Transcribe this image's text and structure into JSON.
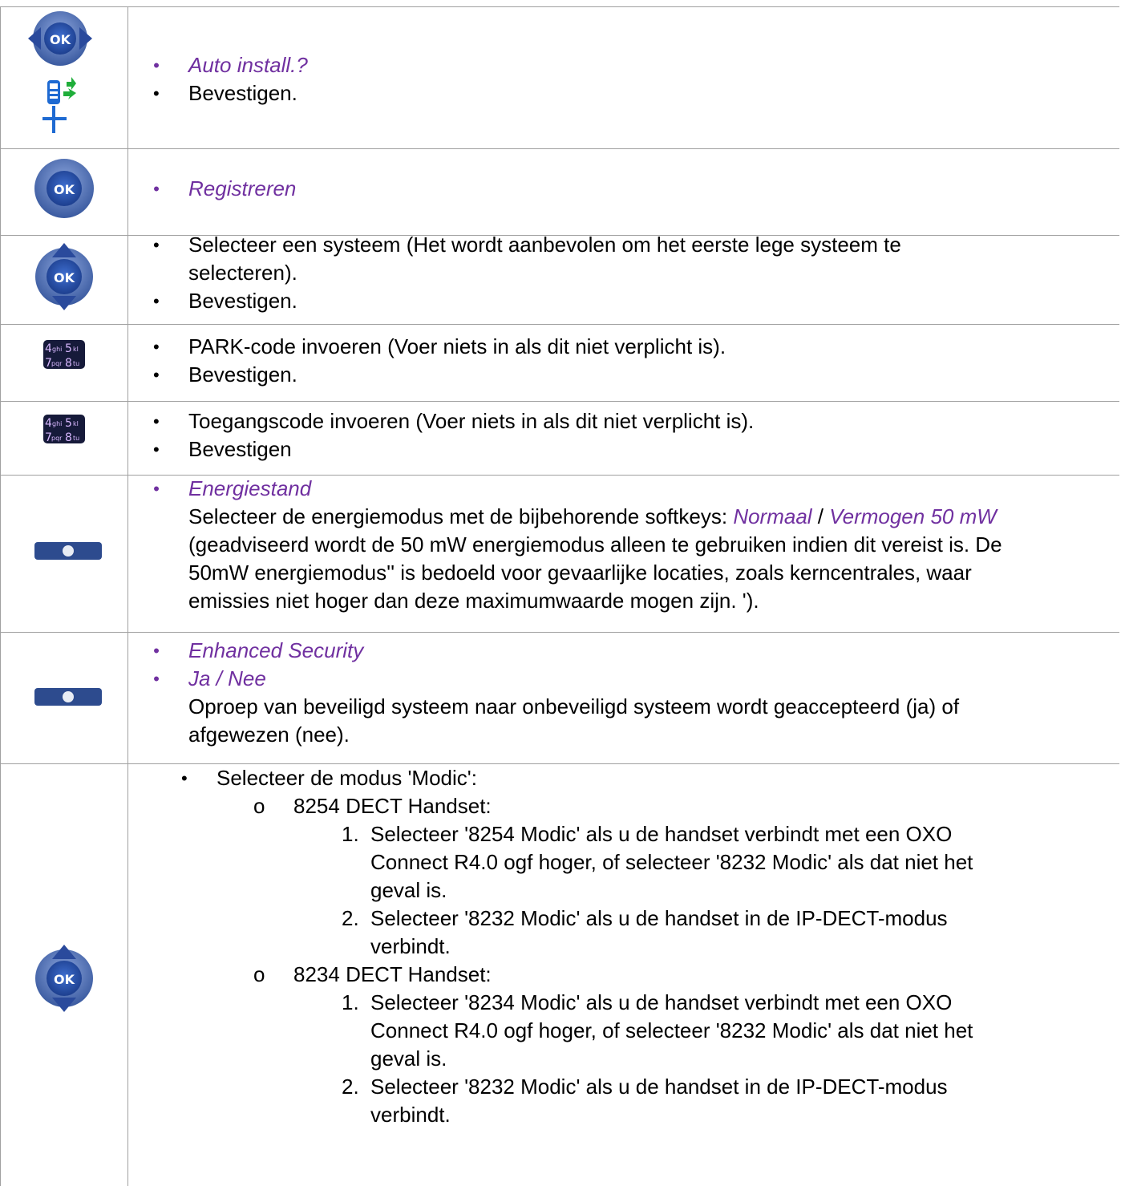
{
  "rows": [
    {
      "icon": "ok-left-right-nav-icon",
      "icon2": "handset-install-icon",
      "items": [
        {
          "text": "Auto install.?",
          "style": "option"
        },
        {
          "text": "Bevestigen.",
          "style": "plain"
        }
      ]
    },
    {
      "icon": "ok-button-icon",
      "items": [
        {
          "text": "Registreren",
          "style": "option"
        }
      ]
    },
    {
      "icon": "ok-up-down-nav-icon",
      "items": [
        {
          "text": "Selecteer een systeem (Het wordt aanbevolen om het eerste lege systeem te",
          "cont": "selecteren).",
          "style": "plain"
        },
        {
          "text": "Bevestigen.",
          "style": "plain"
        }
      ]
    },
    {
      "icon": "keypad-icon",
      "items": [
        {
          "text": "PARK-code invoeren (Voer niets in als dit niet verplicht is).",
          "style": "plain"
        },
        {
          "text": "Bevestigen.",
          "style": "plain"
        }
      ]
    },
    {
      "icon": "keypad-icon",
      "items": [
        {
          "text": "Toegangscode invoeren (Voer niets in als dit niet verplicht is).",
          "style": "plain"
        },
        {
          "text": "Bevestigen",
          "style": "plain"
        }
      ]
    },
    {
      "icon": "softkey-icon",
      "title": "Energiestand",
      "lead": "Selecteer de energiemodus met de bijbehorende softkeys: ",
      "opt_a": "Normaal",
      "sep": " / ",
      "opt_b": "Vermogen 50 mW",
      "lines": [
        "(geadviseerd wordt de 50 mW energiemodus alleen te gebruiken indien dit vereist is. De",
        "50mW energiemodus'' is bedoeld voor gevaarlijke locaties, zoals kerncentrales, waar",
        "emissies niet hoger dan deze maximumwaarde mogen zijn. ')."
      ]
    },
    {
      "icon": "softkey-icon",
      "title": "Enhanced Security",
      "title2": "Ja / Nee",
      "lines": [
        "Oproep van beveiligd systeem naar onbeveiligd systeem wordt geaccepteerd (ja) of",
        "afgewezen (nee)."
      ]
    },
    {
      "icon": "ok-up-down-nav-icon",
      "head": "Selecteer de modus 'Modic':",
      "groups": [
        {
          "label": "8254 DECT Handset:",
          "steps": [
            {
              "num": "1.",
              "lines": [
                "Selecteer '8254 Modic' als u de handset verbindt met een OXO",
                "Connect R4.0 ogf hoger, of selecteer '8232 Modic' als dat niet het",
                "geval is."
              ]
            },
            {
              "num": "2.",
              "lines": [
                "Selecteer '8232 Modic' als u de handset in de IP-DECT-modus",
                "verbindt."
              ]
            }
          ]
        },
        {
          "label": "8234 DECT Handset:",
          "steps": [
            {
              "num": "1.",
              "lines": [
                "Selecteer '8234 Modic' als u de handset verbindt met een OXO",
                "Connect R4.0 ogf hoger, of selecteer '8232 Modic' als dat niet het",
                "geval is."
              ]
            },
            {
              "num": "2.",
              "lines": [
                "Selecteer '8232 Modic' als u de handset in de IP-DECT-modus",
                "verbindt."
              ]
            }
          ]
        }
      ]
    },
    {
      "sub_marker": "o",
      "bullet": "•"
    }
  ],
  "icons": {
    "ok_label": "OK",
    "keypad_keys": [
      "4",
      "ghi",
      "5",
      "kl",
      "7",
      "pqr",
      "8",
      "tu"
    ]
  },
  "colors": {
    "option_text": "#7030a0",
    "grid": "#a0a0a0",
    "nav_blue": "#3b5ba8"
  }
}
